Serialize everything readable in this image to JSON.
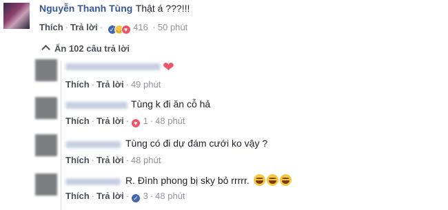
{
  "main_comment": {
    "author": "Nguyễn Thanh Tùng",
    "text": "Thật á ???!!!",
    "like_label": "Thích",
    "reply_label": "Trả lời",
    "reaction_count": "416",
    "timestamp": "50 phút"
  },
  "hide_replies": "Ẩn 102 câu trả lời",
  "replies": [
    {
      "text": "",
      "like_label": "Thích",
      "reply_label": "Trả lời",
      "reaction_count": "",
      "timestamp": "49 phút"
    },
    {
      "text": "Tùng k đi ăn cỗ hả",
      "like_label": "Thích",
      "reply_label": "Trả lời",
      "reaction_count": "1",
      "timestamp": "48 phút"
    },
    {
      "text": "Tùng có đi dự đám cưới ko vậy ?",
      "like_label": "Thích",
      "reply_label": "Trả lời",
      "reaction_count": "",
      "timestamp": "48 phút"
    },
    {
      "text": "R. Đình phong bị sky bỏ rrrrr.",
      "like_label": "Thích",
      "reply_label": "Trả lời",
      "reaction_count": "3",
      "timestamp": "48 phút"
    }
  ],
  "icons": {
    "like": "like-reaction-icon",
    "haha": "haha-reaction-icon",
    "love": "love-reaction-icon",
    "emoji": "laughing-tears-emoji",
    "collapse": "chevron-up-icon"
  },
  "colors": {
    "author": "#365899",
    "action_link": "#4b4f56",
    "meta": "#90949c",
    "like": "#4267b2",
    "love": "#f25268"
  }
}
